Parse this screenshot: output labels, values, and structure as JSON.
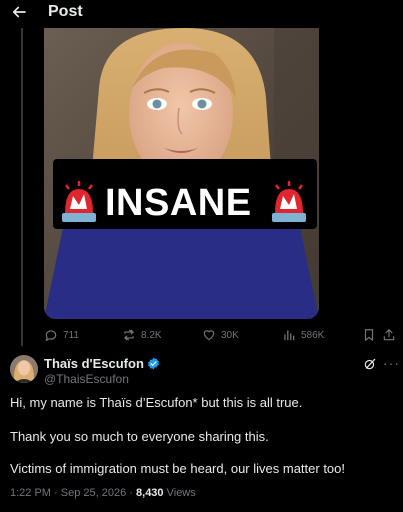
{
  "header": {
    "title": "Post"
  },
  "media": {
    "overlay_text": "INSANE"
  },
  "actions": {
    "replies": "711",
    "reposts": "8.2K",
    "likes": "30K",
    "views": "586K"
  },
  "author": {
    "name": "Thaïs d'Escufon",
    "handle": "@ThaisEscufon",
    "verified_color": "#1d9bf0"
  },
  "tweet": {
    "lines": [
      "Hi, my name is Thaïs d’Escufon* but this is all true.",
      "Thank you so much to everyone sharing this.",
      "Victims of immigration must be heard, our lives matter too!"
    ]
  },
  "meta": {
    "time": "1:22 PM",
    "separator": "·",
    "date": "Sep 25, 2026",
    "views_count": "8,430",
    "views_label": "Views"
  },
  "colors": {
    "bg": "#000000",
    "text": "#e7e9ea",
    "muted": "#71767b",
    "accent": "#1d9bf0"
  }
}
